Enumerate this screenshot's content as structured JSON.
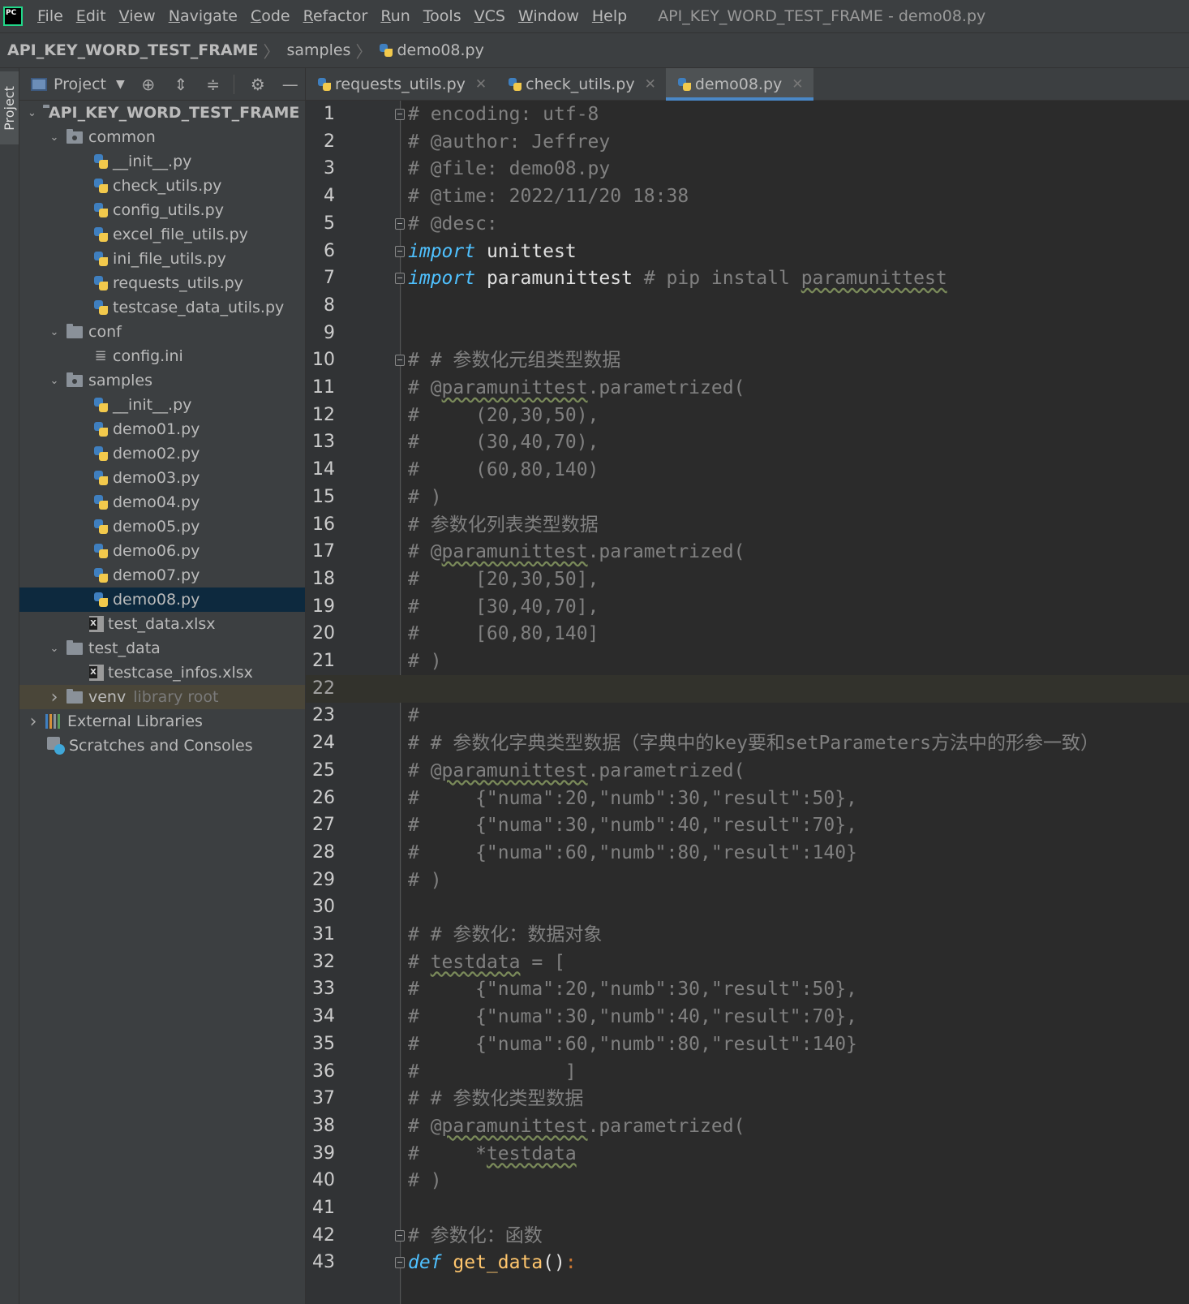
{
  "menubar": {
    "items": [
      {
        "label": "File",
        "u": "F",
        "rest": "ile"
      },
      {
        "label": "Edit",
        "u": "E",
        "rest": "dit"
      },
      {
        "label": "View",
        "u": "V",
        "rest": "iew"
      },
      {
        "label": "Navigate",
        "u": "N",
        "rest": "avigate"
      },
      {
        "label": "Code",
        "u": "C",
        "rest": "ode"
      },
      {
        "label": "Refactor",
        "u": "R",
        "rest": "efactor"
      },
      {
        "label": "Run",
        "u": "R",
        "rest": "un"
      },
      {
        "label": "Tools",
        "u": "T",
        "rest": "ools"
      },
      {
        "label": "VCS",
        "u": "V",
        "rest": "CS"
      },
      {
        "label": "Window",
        "u": "W",
        "rest": "indow"
      },
      {
        "label": "Help",
        "u": "H",
        "rest": "elp"
      }
    ],
    "window_title": "API_KEY_WORD_TEST_FRAME - demo08.py",
    "logo_text": "PC"
  },
  "breadcrumb": {
    "root": "API_KEY_WORD_TEST_FRAME",
    "folder": "samples",
    "file": "demo08.py"
  },
  "sidebar": {
    "tab_label": "Project"
  },
  "project_panel": {
    "title": "Project",
    "root_label": "API_KEY_WORD_TEST_FRAME",
    "root_trunc": "E",
    "common": "common",
    "common_files": [
      "__init__.py",
      "check_utils.py",
      "config_utils.py",
      "excel_file_utils.py",
      "ini_file_utils.py",
      "requests_utils.py",
      "testcase_data_utils.py"
    ],
    "conf": "conf",
    "conf_files": [
      "config.ini"
    ],
    "samples": "samples",
    "samples_files": [
      "__init__.py",
      "demo01.py",
      "demo02.py",
      "demo03.py",
      "demo04.py",
      "demo05.py",
      "demo06.py",
      "demo07.py",
      "demo08.py"
    ],
    "samples_xlsx": "test_data.xlsx",
    "test_data": "test_data",
    "test_data_files": [
      "testcase_infos.xlsx"
    ],
    "venv": "venv",
    "venv_hint": "library root",
    "external_libraries": "External Libraries",
    "scratches": "Scratches and Consoles"
  },
  "editor_tabs": [
    {
      "label": "requests_utils.py",
      "active": false
    },
    {
      "label": "check_utils.py",
      "active": false
    },
    {
      "label": "demo08.py",
      "active": true
    }
  ],
  "colors": {
    "accent": "#4a88c7",
    "selection": "#0d293e",
    "comment": "#808080",
    "keyword": "#4fc1ff"
  },
  "editor": {
    "current_line": 22,
    "lines": [
      {
        "n": "1",
        "fold": true,
        "parts": [
          {
            "t": "# encoding: utf-8",
            "c": "c-comment"
          }
        ]
      },
      {
        "n": "2",
        "parts": [
          {
            "t": "# @author: Jeffrey",
            "c": "c-comment"
          }
        ]
      },
      {
        "n": "3",
        "parts": [
          {
            "t": "# @file: demo08.py",
            "c": "c-comment"
          }
        ]
      },
      {
        "n": "4",
        "parts": [
          {
            "t": "# @time: 2022/11/20 18:38",
            "c": "c-comment"
          }
        ]
      },
      {
        "n": "5",
        "fold": true,
        "parts": [
          {
            "t": "# @desc:",
            "c": "c-comment"
          }
        ]
      },
      {
        "n": "6",
        "fold": true,
        "parts": [
          {
            "t": "import",
            "c": "c-kw2"
          },
          {
            "t": " unittest",
            "c": "c-plain"
          }
        ]
      },
      {
        "n": "7",
        "fold": true,
        "parts": [
          {
            "t": "import",
            "c": "c-kw2"
          },
          {
            "t": " paramunittest",
            "c": "c-plain"
          },
          {
            "t": " # pip install ",
            "c": "c-comment"
          },
          {
            "t": "paramunittest",
            "c": "c-comment squiggle"
          }
        ]
      },
      {
        "n": "8",
        "parts": []
      },
      {
        "n": "9",
        "parts": []
      },
      {
        "n": "10",
        "fold": true,
        "parts": [
          {
            "t": "# # 参数化元组类型数据",
            "c": "c-comment"
          }
        ]
      },
      {
        "n": "11",
        "parts": [
          {
            "t": "# @",
            "c": "c-comment"
          },
          {
            "t": "paramunittest",
            "c": "c-comment squiggle"
          },
          {
            "t": ".parametrized(",
            "c": "c-comment"
          }
        ]
      },
      {
        "n": "12",
        "parts": [
          {
            "t": "#     (20,30,50),",
            "c": "c-comment"
          }
        ]
      },
      {
        "n": "13",
        "parts": [
          {
            "t": "#     (30,40,70),",
            "c": "c-comment"
          }
        ]
      },
      {
        "n": "14",
        "parts": [
          {
            "t": "#     (60,80,140)",
            "c": "c-comment"
          }
        ]
      },
      {
        "n": "15",
        "parts": [
          {
            "t": "# )",
            "c": "c-comment"
          }
        ]
      },
      {
        "n": "16",
        "parts": [
          {
            "t": "# 参数化列表类型数据",
            "c": "c-comment"
          }
        ]
      },
      {
        "n": "17",
        "parts": [
          {
            "t": "# @",
            "c": "c-comment"
          },
          {
            "t": "paramunittest",
            "c": "c-comment squiggle"
          },
          {
            "t": ".parametrized(",
            "c": "c-comment"
          }
        ]
      },
      {
        "n": "18",
        "parts": [
          {
            "t": "#     [20,30,50],",
            "c": "c-comment"
          }
        ]
      },
      {
        "n": "19",
        "parts": [
          {
            "t": "#     [30,40,70],",
            "c": "c-comment"
          }
        ]
      },
      {
        "n": "20",
        "parts": [
          {
            "t": "#     [60,80,140]",
            "c": "c-comment"
          }
        ]
      },
      {
        "n": "21",
        "parts": [
          {
            "t": "# )",
            "c": "c-comment"
          }
        ]
      },
      {
        "n": "22",
        "parts": []
      },
      {
        "n": "23",
        "parts": [
          {
            "t": "#",
            "c": "c-comment"
          }
        ]
      },
      {
        "n": "24",
        "parts": [
          {
            "t": "# # 参数化字典类型数据（字典中的key要和setParameters方法中的形参一致）",
            "c": "c-comment"
          }
        ]
      },
      {
        "n": "25",
        "parts": [
          {
            "t": "# @",
            "c": "c-comment"
          },
          {
            "t": "paramunittest",
            "c": "c-comment squiggle"
          },
          {
            "t": ".parametrized(",
            "c": "c-comment"
          }
        ]
      },
      {
        "n": "26",
        "parts": [
          {
            "t": "#     {\"numa\":20,\"numb\":30,\"result\":50},",
            "c": "c-comment"
          }
        ]
      },
      {
        "n": "27",
        "parts": [
          {
            "t": "#     {\"numa\":30,\"numb\":40,\"result\":70},",
            "c": "c-comment"
          }
        ]
      },
      {
        "n": "28",
        "parts": [
          {
            "t": "#     {\"numa\":60,\"numb\":80,\"result\":140}",
            "c": "c-comment"
          }
        ]
      },
      {
        "n": "29",
        "parts": [
          {
            "t": "# )",
            "c": "c-comment"
          }
        ]
      },
      {
        "n": "30",
        "parts": []
      },
      {
        "n": "31",
        "parts": [
          {
            "t": "# # 参数化：数据对象",
            "c": "c-comment"
          }
        ]
      },
      {
        "n": "32",
        "parts": [
          {
            "t": "# ",
            "c": "c-comment"
          },
          {
            "t": "testdata",
            "c": "c-comment squiggle"
          },
          {
            "t": " = [",
            "c": "c-comment"
          }
        ]
      },
      {
        "n": "33",
        "parts": [
          {
            "t": "#     {\"numa\":20,\"numb\":30,\"result\":50},",
            "c": "c-comment"
          }
        ]
      },
      {
        "n": "34",
        "parts": [
          {
            "t": "#     {\"numa\":30,\"numb\":40,\"result\":70},",
            "c": "c-comment"
          }
        ]
      },
      {
        "n": "35",
        "parts": [
          {
            "t": "#     {\"numa\":60,\"numb\":80,\"result\":140}",
            "c": "c-comment"
          }
        ]
      },
      {
        "n": "36",
        "parts": [
          {
            "t": "#             ]",
            "c": "c-comment"
          }
        ]
      },
      {
        "n": "37",
        "parts": [
          {
            "t": "# # 参数化类型数据",
            "c": "c-comment"
          }
        ]
      },
      {
        "n": "38",
        "parts": [
          {
            "t": "# @",
            "c": "c-comment"
          },
          {
            "t": "paramunittest",
            "c": "c-comment squiggle"
          },
          {
            "t": ".parametrized(",
            "c": "c-comment"
          }
        ]
      },
      {
        "n": "39",
        "parts": [
          {
            "t": "#     *",
            "c": "c-comment"
          },
          {
            "t": "testdata",
            "c": "c-comment squiggle"
          }
        ]
      },
      {
        "n": "40",
        "parts": [
          {
            "t": "# )",
            "c": "c-comment"
          }
        ]
      },
      {
        "n": "41",
        "parts": []
      },
      {
        "n": "42",
        "fold": true,
        "parts": [
          {
            "t": "# 参数化：函数",
            "c": "c-comment"
          }
        ]
      },
      {
        "n": "43",
        "fold": true,
        "parts": [
          {
            "t": "def",
            "c": "c-kw2"
          },
          {
            "t": " get_data",
            "c": "c-fn"
          },
          {
            "t": "()",
            "c": "c-paren"
          },
          {
            "t": ":",
            "c": "c-colon"
          }
        ]
      }
    ]
  }
}
